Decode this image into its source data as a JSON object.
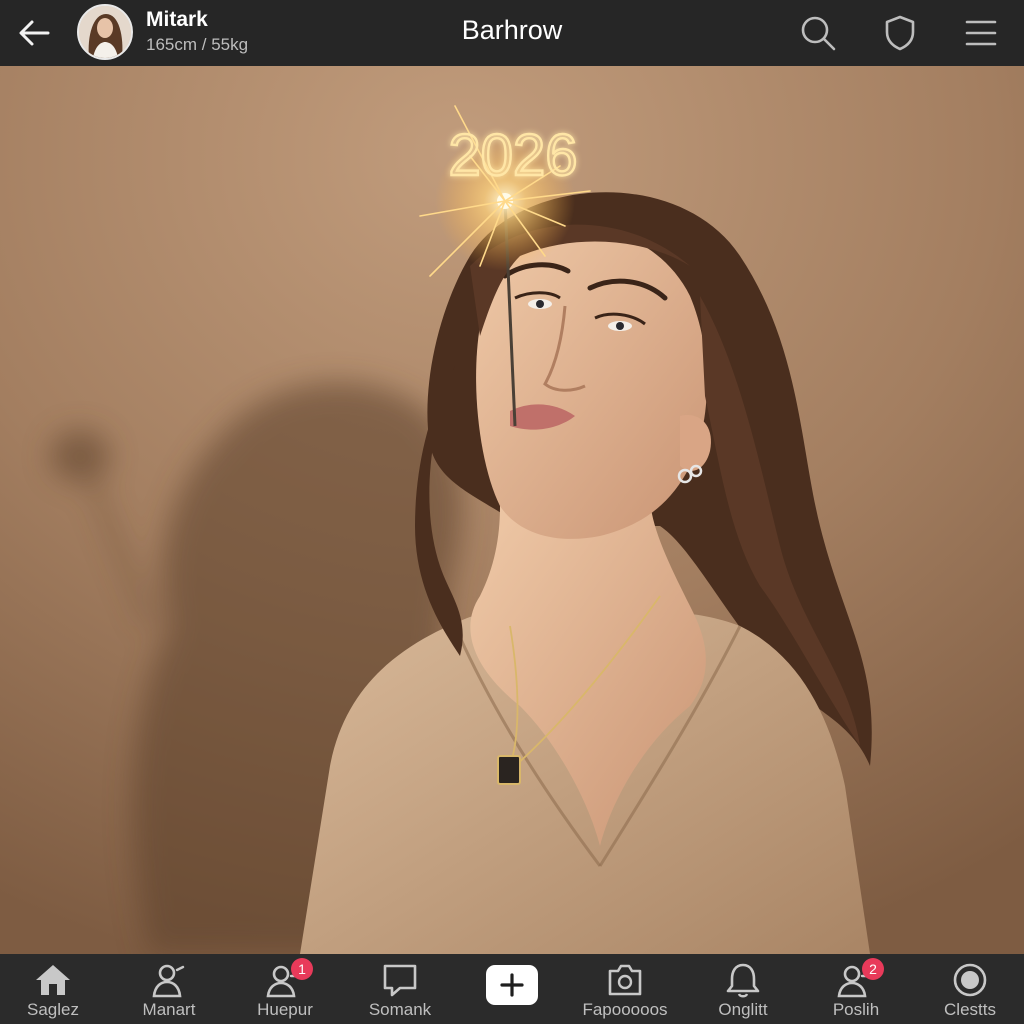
{
  "header": {
    "user_name": "Mitark",
    "user_stats": "165cm / 55kg",
    "title": "Barhrow"
  },
  "photo": {
    "sparkler_text": "2026"
  },
  "bottom_nav": {
    "items": [
      {
        "label": "Saglez",
        "icon": "home-icon"
      },
      {
        "label": "Manart",
        "icon": "person-icon"
      },
      {
        "label": "Huepur",
        "icon": "people-icon",
        "badge": "1"
      },
      {
        "label": "Somank",
        "icon": "chat-icon"
      },
      {
        "label": "",
        "icon": "plus-icon"
      },
      {
        "label": "Fapooooos",
        "icon": "camera-icon"
      },
      {
        "label": "Onglitt",
        "icon": "bell-icon"
      },
      {
        "label": "Poslih",
        "icon": "people-icon",
        "badge": "2"
      },
      {
        "label": "Clestts",
        "icon": "settings-icon"
      }
    ]
  },
  "colors": {
    "bar_bg": "#262626",
    "nav_bg": "#2b2b2b",
    "badge": "#e83a5a",
    "backdrop": "#a37e60"
  }
}
